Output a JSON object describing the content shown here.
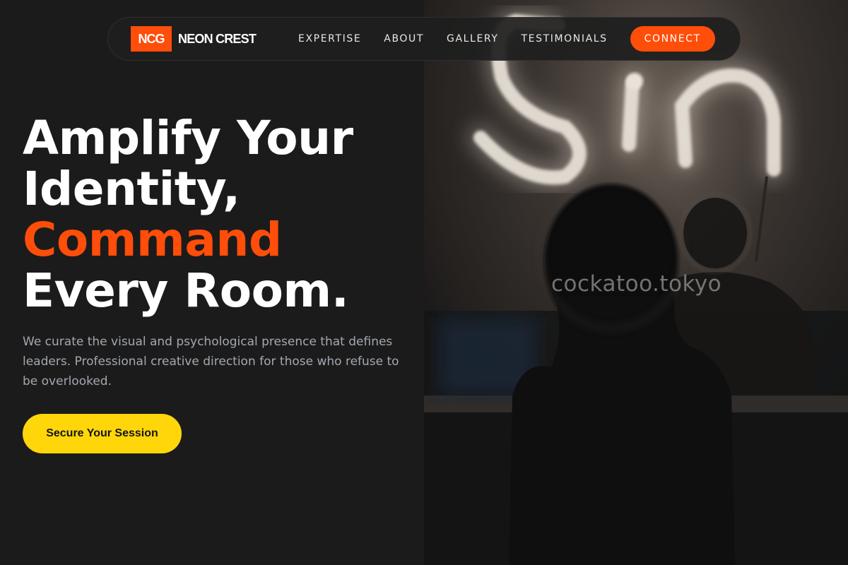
{
  "brand": {
    "badge": "NCG",
    "name": "NEON CREST"
  },
  "nav": {
    "links": [
      "EXPERTISE",
      "ABOUT",
      "GALLERY",
      "TESTIMONIALS"
    ],
    "cta_label": "CONNECT"
  },
  "hero": {
    "title_line1": "Amplify Your",
    "title_line2": "Identity,",
    "title_accent": "Command",
    "title_line4": "Every Room.",
    "subtitle": "We curate the visual and psychological presence that defines leaders. Professional creative direction for those who refuse to be overlooked.",
    "cta_label": "Secure Your Session"
  },
  "photo": {
    "watermark": "cockatoo.tokyo"
  },
  "colors": {
    "background": "#1b1b1b",
    "accent_orange": "#ff4d0a",
    "cta_yellow": "#ffd60a",
    "muted_text": "#a3a8b0"
  }
}
